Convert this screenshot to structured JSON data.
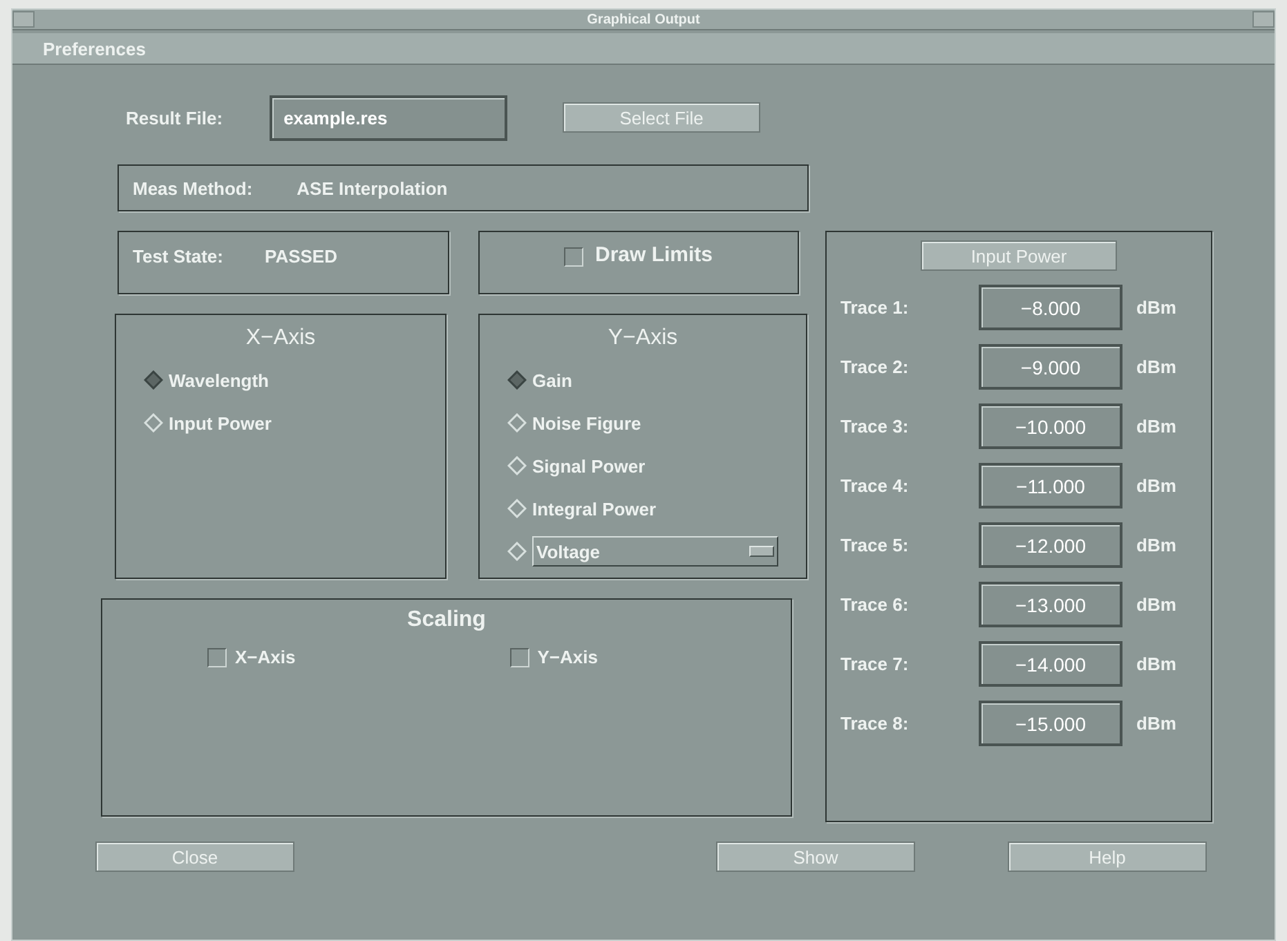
{
  "window": {
    "title": "Graphical Output"
  },
  "menu": [
    "Preferences"
  ],
  "result_file": {
    "label": "Result File:",
    "value": "example.res",
    "button": "Select File"
  },
  "meas_method": {
    "label": "Meas Method:",
    "value": "ASE Interpolation"
  },
  "test_state": {
    "label": "Test State:",
    "value": "PASSED"
  },
  "draw_limits": {
    "label": "Draw Limits",
    "checked": false
  },
  "x_axis": {
    "title": "X−Axis",
    "options": [
      {
        "label": "Wavelength",
        "selected": true
      },
      {
        "label": "Input Power",
        "selected": false
      }
    ]
  },
  "y_axis": {
    "title": "Y−Axis",
    "options": [
      {
        "kind": "radio",
        "label": "Gain",
        "selected": true
      },
      {
        "kind": "radio",
        "label": "Noise Figure",
        "selected": false
      },
      {
        "kind": "radio",
        "label": "Signal Power",
        "selected": false
      },
      {
        "kind": "radio",
        "label": "Integral Power",
        "selected": false
      },
      {
        "kind": "dropdown",
        "label": "Voltage",
        "selected": false
      }
    ]
  },
  "scaling": {
    "title": "Scaling",
    "options": [
      {
        "label": "X−Axis",
        "checked": false
      },
      {
        "label": "Y−Axis",
        "checked": false
      }
    ]
  },
  "input_power": {
    "button": "Input Power",
    "traces": [
      {
        "label": "Trace 1:",
        "value": "−8.000",
        "unit": "dBm"
      },
      {
        "label": "Trace 2:",
        "value": "−9.000",
        "unit": "dBm"
      },
      {
        "label": "Trace 3:",
        "value": "−10.000",
        "unit": "dBm"
      },
      {
        "label": "Trace 4:",
        "value": "−11.000",
        "unit": "dBm"
      },
      {
        "label": "Trace 5:",
        "value": "−12.000",
        "unit": "dBm"
      },
      {
        "label": "Trace 6:",
        "value": "−13.000",
        "unit": "dBm"
      },
      {
        "label": "Trace 7:",
        "value": "−14.000",
        "unit": "dBm"
      },
      {
        "label": "Trace 8:",
        "value": "−15.000",
        "unit": "dBm"
      }
    ]
  },
  "buttons": [
    "Close",
    "Show",
    "Help"
  ]
}
